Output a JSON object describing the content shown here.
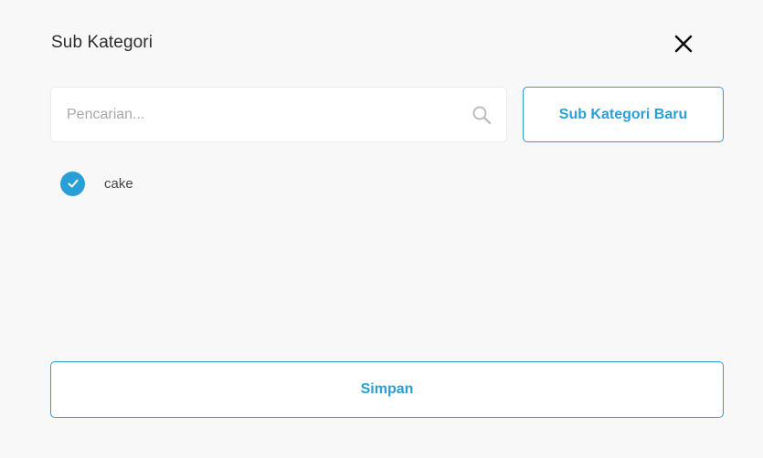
{
  "modal": {
    "title": "Sub Kategori",
    "close_icon": "close-icon"
  },
  "search": {
    "placeholder": "Pencarian...",
    "value": "",
    "icon": "search-icon"
  },
  "new_subcategory_button": {
    "label": "Sub Kategori Baru"
  },
  "subcategories": [
    {
      "label": "cake",
      "checked": true,
      "icon": "checkmark-icon"
    }
  ],
  "save_button": {
    "label": "Simpan"
  },
  "colors": {
    "accent": "#2a9fd6",
    "background": "#f8f8f8",
    "border": "#ebebeb",
    "title_text": "#2d2d2d",
    "placeholder_text": "#a8a8a8"
  }
}
